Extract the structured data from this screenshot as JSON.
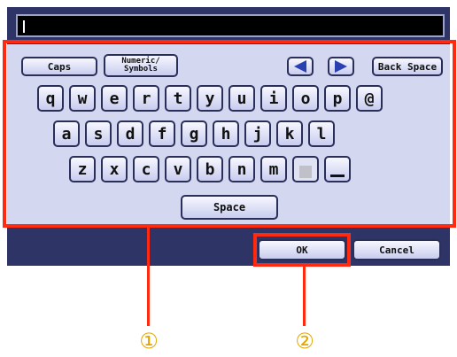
{
  "input": {
    "value": ""
  },
  "toolbar": {
    "caps": "Caps",
    "numeric_line1": "Numeric/",
    "numeric_line2": "Symbols",
    "left_arrow_icon": "left-arrow-icon",
    "right_arrow_icon": "right-arrow-icon",
    "back_space": "Back Space"
  },
  "keyboard": {
    "row1": [
      "q",
      "w",
      "e",
      "r",
      "t",
      "y",
      "u",
      "i",
      "o",
      "p",
      "@"
    ],
    "row2": [
      "a",
      "s",
      "d",
      "f",
      "g",
      "h",
      "j",
      "k",
      "l"
    ],
    "row3": [
      "z",
      "x",
      "c",
      "v",
      "b",
      "n",
      "m"
    ],
    "space": "Space"
  },
  "footer": {
    "ok": "OK",
    "cancel": "Cancel"
  },
  "callouts": {
    "one": "①",
    "two": "②"
  },
  "colors": {
    "highlight": "#ff2a10",
    "panel": "#2e3566",
    "callout_number": "#e3a600"
  }
}
